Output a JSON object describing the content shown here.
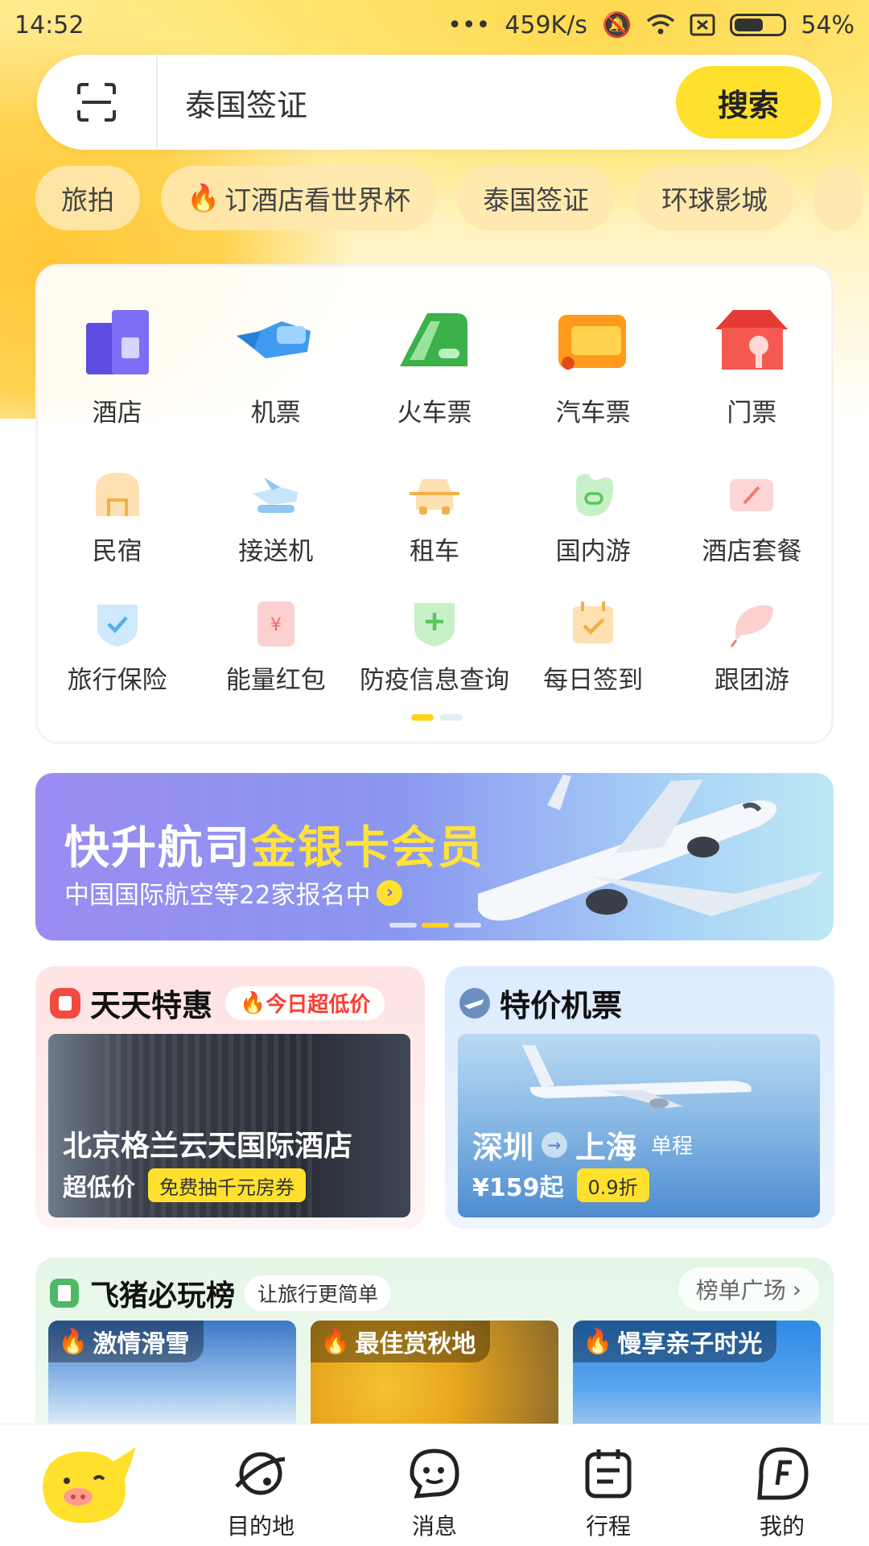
{
  "status_bar": {
    "time": "14:52",
    "dots": "•••",
    "speed": "459K/s",
    "battery": "54%"
  },
  "search": {
    "query": "泰国签证",
    "button": "搜索"
  },
  "hot_chips": [
    {
      "label": "旅拍",
      "hot": false
    },
    {
      "label": "订酒店看世界杯",
      "hot": true
    },
    {
      "label": "泰国签证",
      "hot": false
    },
    {
      "label": "环球影城",
      "hot": false
    }
  ],
  "services": {
    "primary": [
      {
        "label": "酒店",
        "icon": "hotel-icon",
        "color": "#6b5df0"
      },
      {
        "label": "机票",
        "icon": "flight-icon",
        "color": "#3ea0f2"
      },
      {
        "label": "火车票",
        "icon": "train-icon",
        "color": "#35b34a"
      },
      {
        "label": "汽车票",
        "icon": "bus-icon",
        "color": "#ff9e1b"
      },
      {
        "label": "门票",
        "icon": "ticket-icon",
        "color": "#f24a43"
      }
    ],
    "row2": [
      {
        "label": "民宿",
        "icon": "homestay-icon",
        "color": "#f7c470"
      },
      {
        "label": "接送机",
        "icon": "airport-transfer-icon",
        "color": "#8ec8f2"
      },
      {
        "label": "租车",
        "icon": "car-rental-icon",
        "color": "#f6c061"
      },
      {
        "label": "国内游",
        "icon": "domestic-tour-icon",
        "color": "#8fd98f"
      },
      {
        "label": "酒店套餐",
        "icon": "hotel-package-icon",
        "color": "#f5a3a3"
      }
    ],
    "row3": [
      {
        "label": "旅行保险",
        "icon": "insurance-icon",
        "color": "#8ccbf0"
      },
      {
        "label": "能量红包",
        "icon": "red-packet-icon",
        "color": "#f5a3a3"
      },
      {
        "label": "防疫信息查询",
        "icon": "epidemic-info-icon",
        "color": "#8fd98f"
      },
      {
        "label": "每日签到",
        "icon": "checkin-icon",
        "color": "#f6c061"
      },
      {
        "label": "跟团游",
        "icon": "group-tour-icon",
        "color": "#f5a3a3"
      }
    ]
  },
  "banner": {
    "title_main": "快升航司",
    "title_highlight": "金银卡会员",
    "subtitle": "中国国际航空等22家报名中"
  },
  "daily_deals": {
    "title": "天天特惠",
    "tag": "今日超低价",
    "hotel_name": "北京格兰云天国际酒店",
    "price_label": "超低价",
    "coupon": "免费抽千元房券"
  },
  "cheap_flights": {
    "title": "特价机票",
    "from": "深圳",
    "to": "上海",
    "trip_type": "单程",
    "price": "¥159起",
    "discount": "0.9折"
  },
  "ranking": {
    "title": "飞猪必玩榜",
    "tag": "让旅行更简单",
    "more": "榜单广场",
    "tiles": [
      "激情滑雪",
      "最佳赏秋地",
      "慢享亲子时光"
    ]
  },
  "tabbar": {
    "items": [
      {
        "label": "目的地",
        "icon": "planet-icon"
      },
      {
        "label": "消息",
        "icon": "message-icon"
      },
      {
        "label": "行程",
        "icon": "itinerary-icon"
      },
      {
        "label": "我的",
        "icon": "profile-icon"
      }
    ]
  },
  "colors": {
    "accent": "#ffe12d",
    "brand_orange": "#ff5b1a"
  }
}
